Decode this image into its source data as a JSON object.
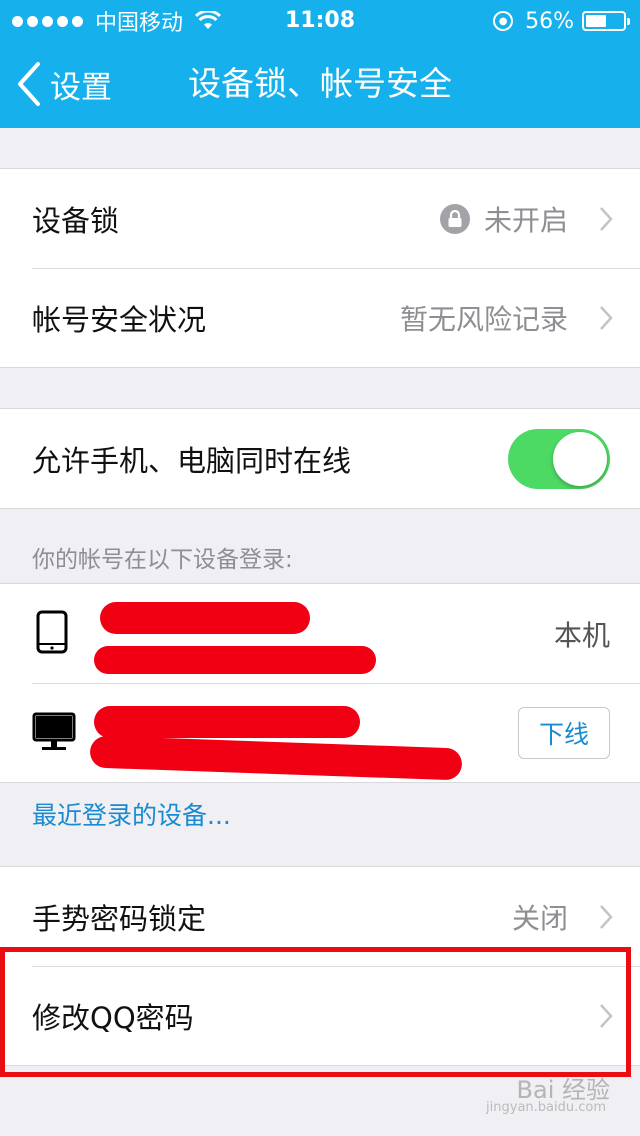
{
  "status_bar": {
    "carrier": "中国移动",
    "time": "11:08",
    "battery": "56%",
    "battery_level": 0.56
  },
  "nav": {
    "back_label": "设置",
    "title": "设备锁、帐号安全"
  },
  "security": {
    "device_lock_label": "设备锁",
    "device_lock_value": "未开启",
    "account_status_label": "帐号安全状况",
    "account_status_value": "暂无风险记录"
  },
  "online": {
    "label": "允许手机、电脑同时在线",
    "enabled": true
  },
  "devices": {
    "caption": "你的帐号在以下设备登录:",
    "phone_status": "本机",
    "logout_label": "下线",
    "recent_link": "最近登录的设备..."
  },
  "gesture": {
    "label": "手势密码锁定",
    "value": "关闭"
  },
  "password": {
    "label": "修改QQ密码"
  },
  "watermark": {
    "text": "Bai 经验",
    "sub": "jingyan.baidu.com"
  },
  "colors": {
    "header": "#16b0ec",
    "toggle_on": "#4cd964",
    "link": "#1a8bd0",
    "highlight": "#ea0d12"
  }
}
